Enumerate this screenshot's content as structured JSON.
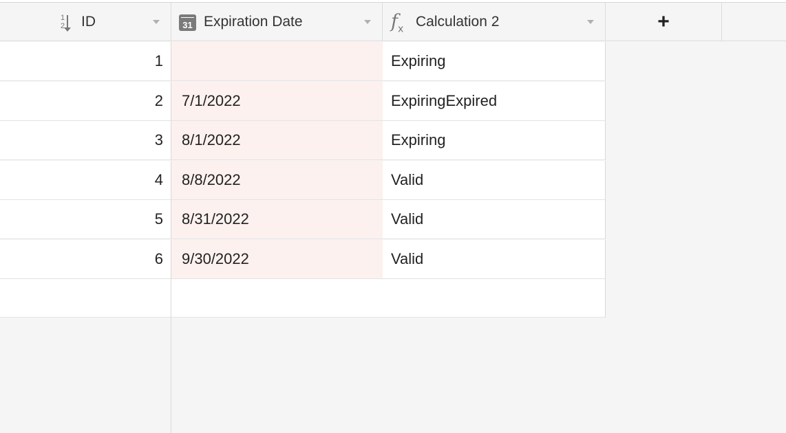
{
  "columns": {
    "id": {
      "label": "ID",
      "icon": "sort-numeric-icon",
      "icon_top": "1",
      "icon_bottom": "2"
    },
    "expiration_date": {
      "label": "Expiration Date",
      "icon": "calendar-icon",
      "icon_text": "31"
    },
    "calculation": {
      "label": "Calculation 2",
      "icon": "formula-icon"
    },
    "add": {
      "label": "+"
    }
  },
  "rows": [
    {
      "id": "1",
      "date": "",
      "calc": "Expiring"
    },
    {
      "id": "2",
      "date": "7/1/2022",
      "calc": "ExpiringExpired"
    },
    {
      "id": "3",
      "date": "8/1/2022",
      "calc": "Expiring"
    },
    {
      "id": "4",
      "date": "8/8/2022",
      "calc": "Valid"
    },
    {
      "id": "5",
      "date": "8/31/2022",
      "calc": "Valid"
    },
    {
      "id": "6",
      "date": "9/30/2022",
      "calc": "Valid"
    }
  ],
  "colors": {
    "date_column_bg": "#fcf1ee",
    "grid_bg": "#f5f5f5"
  }
}
